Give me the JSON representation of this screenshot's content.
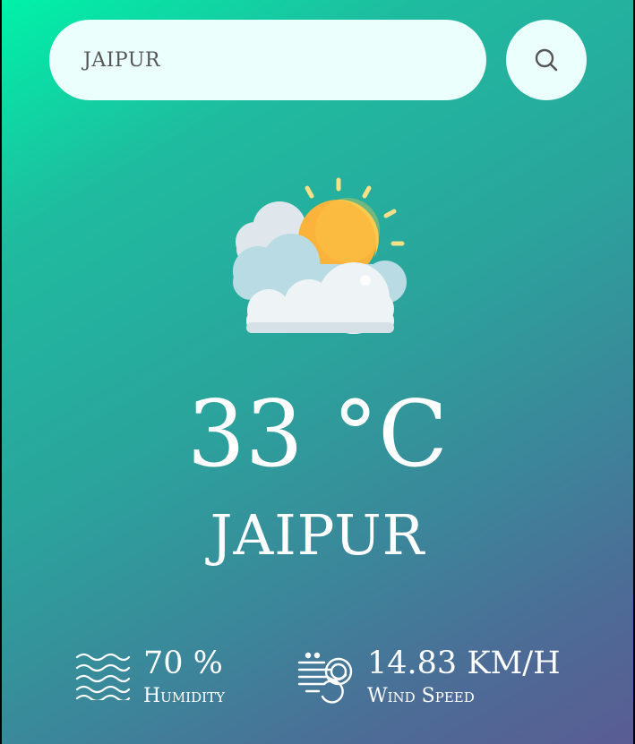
{
  "search": {
    "value": "JAIPUR",
    "icon": "search-icon"
  },
  "weather": {
    "icon": "partly-cloudy-icon",
    "temperature": "33 °C",
    "city": "JAIPUR"
  },
  "details": {
    "humidity": {
      "icon": "humidity-icon",
      "value": "70 %",
      "label": "Humidity"
    },
    "wind": {
      "icon": "wind-icon",
      "value": "14.83 KM/H",
      "label": "Wind Speed"
    }
  },
  "colors": {
    "gradient_start": "#00f2a8",
    "gradient_end": "#5a5c93",
    "field_background": "#ebfffc",
    "sun": "#fbb33b",
    "cloud": "#eef3f5"
  }
}
